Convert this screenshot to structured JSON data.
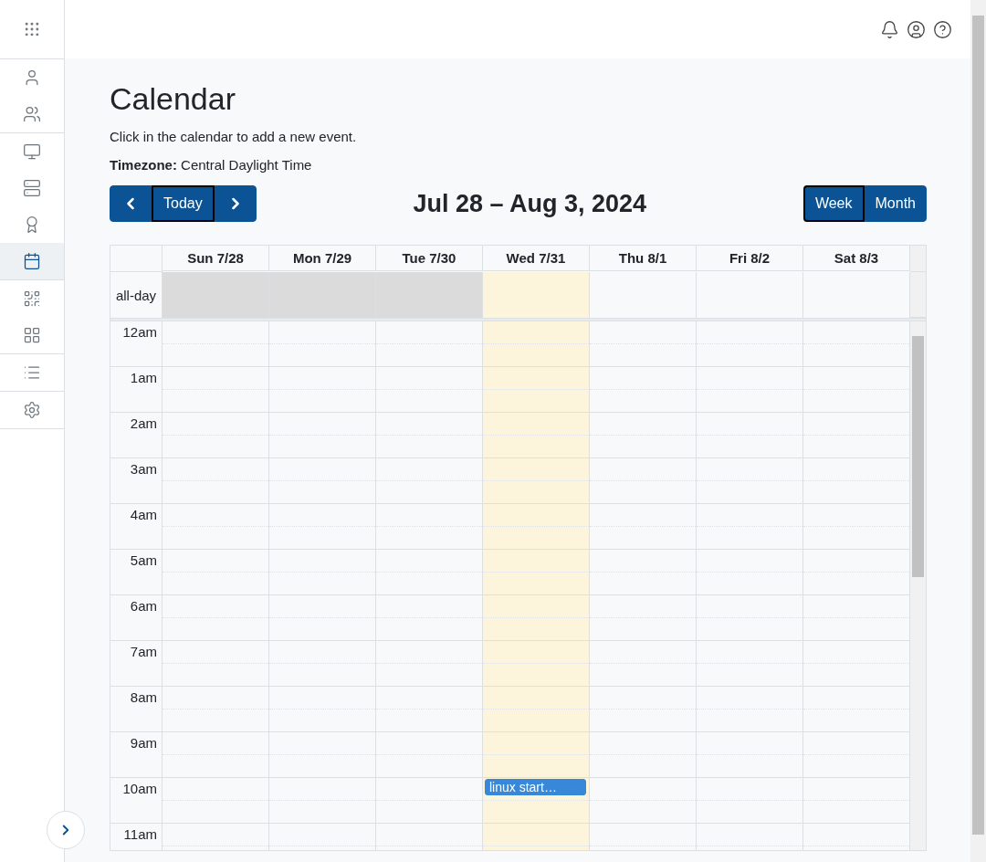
{
  "sidebar": {
    "groups": [
      {
        "items": [
          {
            "selected": false
          },
          {
            "selected": false
          }
        ]
      },
      {
        "items": [
          {
            "selected": false
          },
          {
            "selected": false
          },
          {
            "selected": false
          },
          {
            "selected": true
          }
        ]
      },
      {
        "items": [
          {
            "selected": false
          },
          {
            "selected": false
          }
        ]
      },
      {
        "items": [
          {
            "selected": false
          }
        ]
      },
      {
        "items": [
          {
            "selected": false
          }
        ]
      }
    ]
  },
  "page": {
    "title": "Calendar",
    "subtitle": "Click in the calendar to add a new event.",
    "timezone_label": "Timezone:",
    "timezone": "Central Daylight Time"
  },
  "toolbar": {
    "today": {
      "label": "Today",
      "focused": true
    },
    "range": "Jul 28 – Aug 3, 2024",
    "views": [
      {
        "label": "Week",
        "selected": true
      },
      {
        "label": "Month",
        "selected": false
      }
    ]
  },
  "calendar": {
    "all_day_label": "all-day",
    "days": [
      {
        "label": "Sun 7/28",
        "past": true,
        "today": false
      },
      {
        "label": "Mon 7/29",
        "past": true,
        "today": false
      },
      {
        "label": "Tue 7/30",
        "past": true,
        "today": false
      },
      {
        "label": "Wed 7/31",
        "past": false,
        "today": true
      },
      {
        "label": "Thu 8/1",
        "past": false,
        "today": false
      },
      {
        "label": "Fri 8/2",
        "past": false,
        "today": false
      },
      {
        "label": "Sat 8/3",
        "past": false,
        "today": false
      }
    ],
    "hours": [
      {
        "label": "12am"
      },
      {
        "label": "1am"
      },
      {
        "label": "2am"
      },
      {
        "label": "3am"
      },
      {
        "label": "4am"
      },
      {
        "label": "5am"
      },
      {
        "label": "6am"
      },
      {
        "label": "7am"
      },
      {
        "label": "8am"
      },
      {
        "label": "9am"
      },
      {
        "label": "10am",
        "events": [
          {
            "title": "linux start…",
            "today": true
          }
        ]
      },
      {
        "label": "11am"
      }
    ]
  }
}
